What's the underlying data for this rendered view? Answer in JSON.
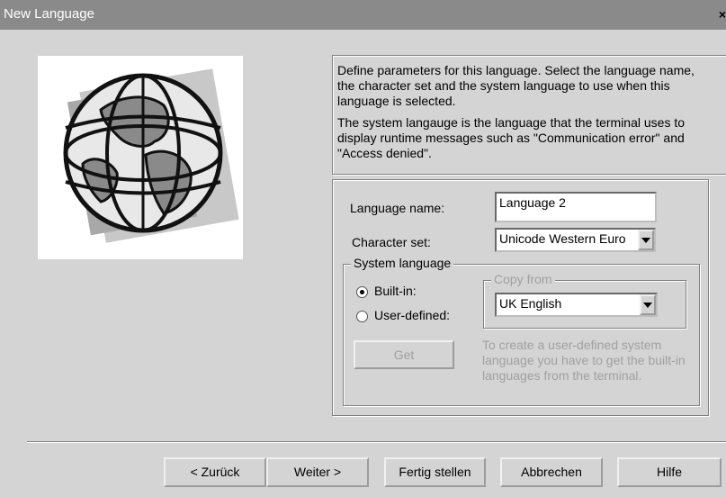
{
  "window": {
    "title": "New Language",
    "close_label": "×"
  },
  "description": {
    "para1": "Define parameters for this language. Select the language name, the character set and the system language to use when this language is selected.",
    "para2": "The system langauge is the language that the terminal uses to display runtime messages such as \"Communication error\" and \"Access denied\"."
  },
  "settings": {
    "language_name_label": "Language name:",
    "language_name_value": "Language 2",
    "character_set_label": "Character set:",
    "character_set_value": "Unicode Western Euro",
    "system_language_legend": "System language",
    "builtin_label": "Built-in:",
    "user_defined_label": "User-defined:",
    "builtin_checked": true,
    "copy_from_legend": "Copy from",
    "copy_from_value": "UK English",
    "get_button": "Get",
    "hint": "To create a user-defined system language you have to get the built-in languages from the terminal."
  },
  "footer": {
    "back": "< Zurück",
    "next": "Weiter >",
    "finish": "Fertig stellen",
    "cancel": "Abbrechen",
    "help": "Hilfe"
  },
  "icons": [
    "globe-image",
    "chevron-down-icon",
    "close-icon"
  ]
}
